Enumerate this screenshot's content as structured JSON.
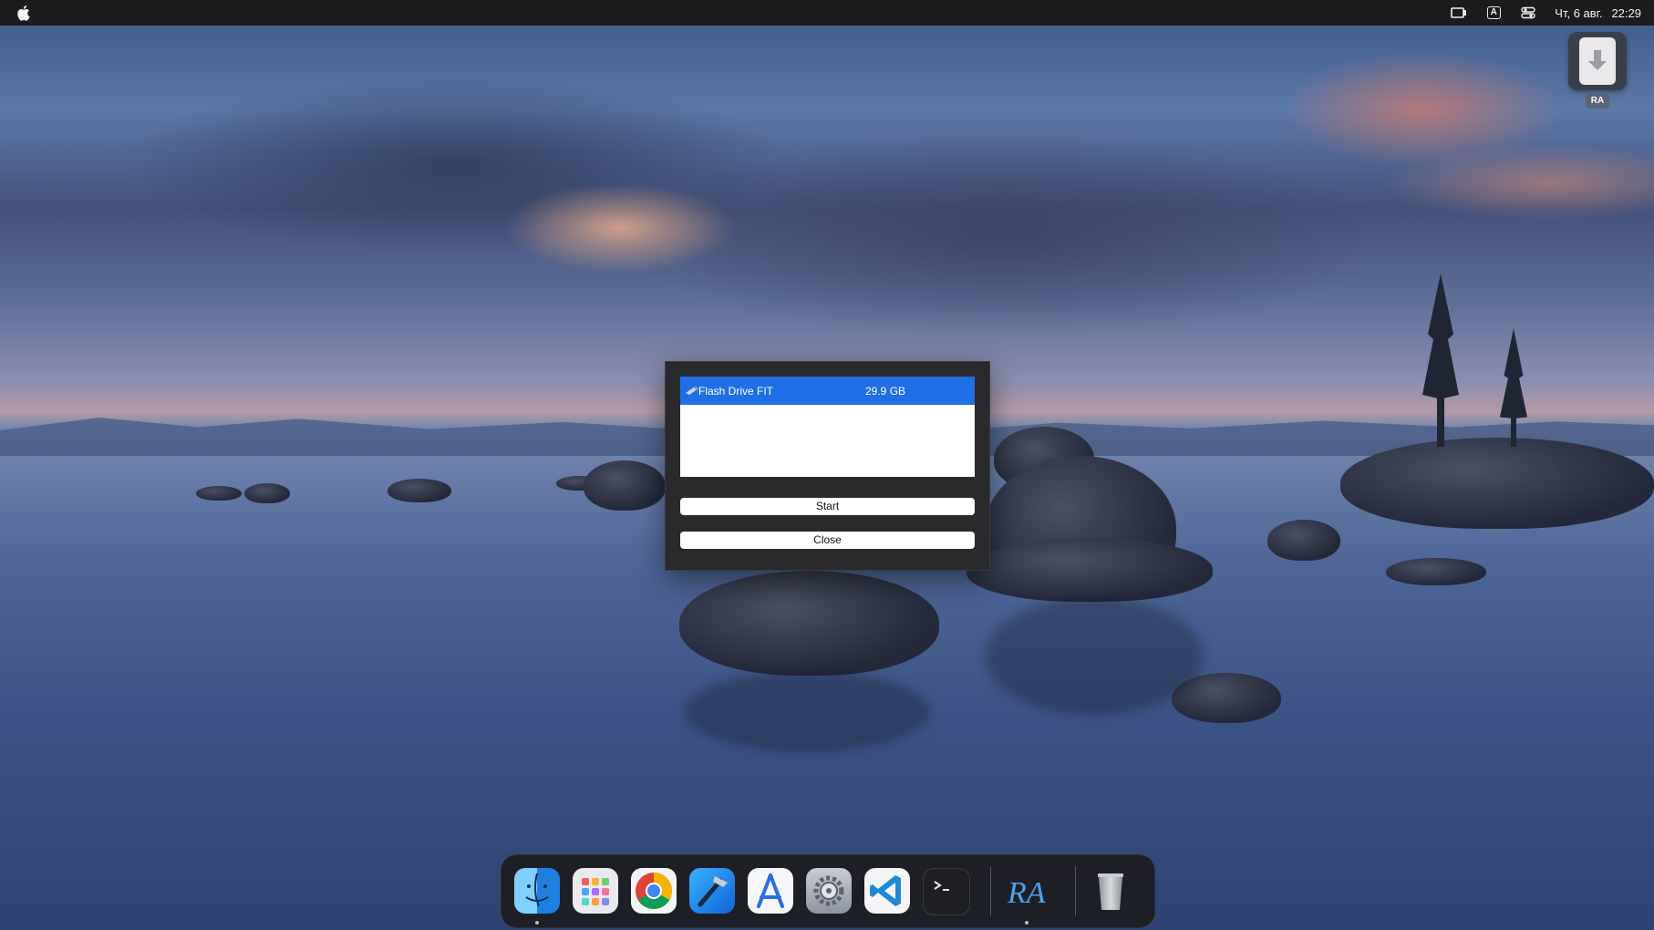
{
  "menubar": {
    "keyboard_layout": "A",
    "date": "Чт, 6 авг.",
    "time": "22:29",
    "icons": [
      "apple-icon",
      "display-icon",
      "keyboard-layout-icon",
      "control-center-icon"
    ]
  },
  "desktop": {
    "item_label": "RA",
    "item_icon": "download-icon"
  },
  "dialog": {
    "devices": [
      {
        "name": "Flash Drive FIT",
        "size": "29.9 GB",
        "icon": "usb-drive-icon",
        "selected": true
      }
    ],
    "start_label": "Start",
    "close_label": "Close"
  },
  "dock": {
    "apps": [
      "finder",
      "launchpad",
      "chrome",
      "xcode",
      "instruments",
      "system-preferences",
      "vscode",
      "terminal",
      "ra",
      "trash"
    ],
    "ra_label": "RA"
  },
  "colors": {
    "selection": "#1f6fe5",
    "menubar": "#1c1c1e",
    "dialog_bg": "#2a2a2c"
  }
}
